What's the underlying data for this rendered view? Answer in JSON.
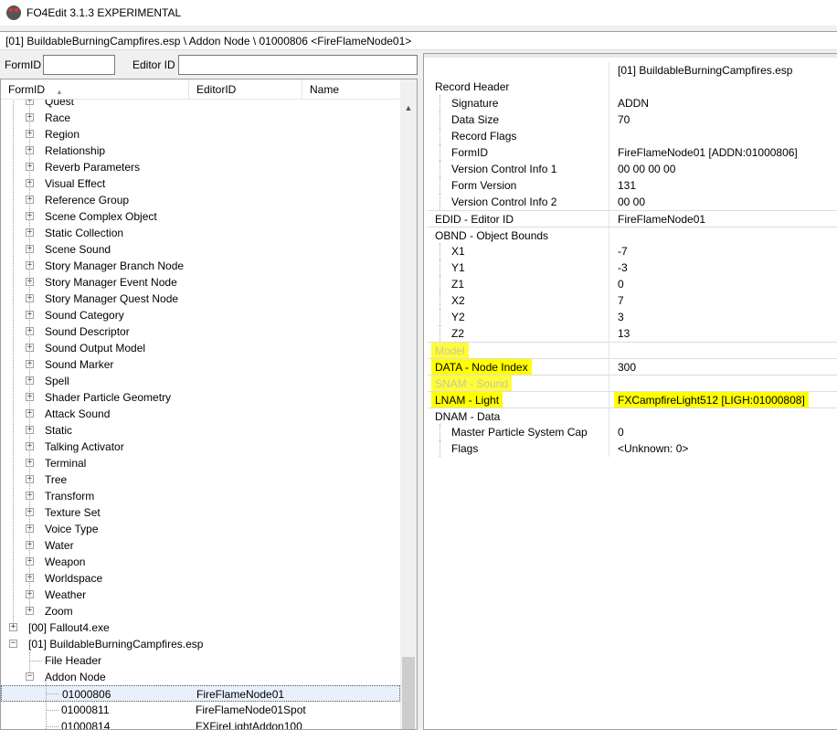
{
  "window": {
    "title": "FO4Edit 3.1.3 EXPERIMENTAL"
  },
  "path": "[01] BuildableBurningCampfires.esp \\ Addon Node \\ 01000806 <FireFlameNode01>",
  "filter": {
    "formid_label": "FormID",
    "formid_value": "",
    "editorid_label": "Editor ID",
    "editorid_value": ""
  },
  "tree": {
    "columns": [
      "FormID",
      "EditorID",
      "Name"
    ],
    "groups": [
      "Quest",
      "Race",
      "Region",
      "Relationship",
      "Reverb Parameters",
      "Visual Effect",
      "Reference Group",
      "Scene Complex Object",
      "Static Collection",
      "Scene Sound",
      "Story Manager Branch Node",
      "Story Manager Event Node",
      "Story Manager Quest Node",
      "Sound Category",
      "Sound Descriptor",
      "Sound Output Model",
      "Sound Marker",
      "Spell",
      "Shader Particle Geometry",
      "Attack Sound",
      "Static",
      "Talking Activator",
      "Terminal",
      "Tree",
      "Transform",
      "Texture Set",
      "Voice Type",
      "Water",
      "Weapon",
      "Worldspace",
      "Weather",
      "Zoom"
    ],
    "files": [
      "[00] Fallout4.exe",
      "[01] BuildableBurningCampfires.esp"
    ],
    "file_children": [
      "File Header",
      "Addon Node"
    ],
    "records": [
      {
        "formid": "01000806",
        "editorid": "FireFlameNode01"
      },
      {
        "formid": "01000811",
        "editorid": "FireFlameNode01Spot"
      },
      {
        "formid": "01000814",
        "editorid": "FXFireLightAddon100"
      }
    ]
  },
  "record": {
    "file_header": "[01] BuildableBurningCampfires.esp",
    "rows": [
      {
        "name": "Record Header",
        "value": "",
        "level": 0
      },
      {
        "name": "Signature",
        "value": "ADDN",
        "level": 1
      },
      {
        "name": "Data Size",
        "value": "70",
        "level": 1
      },
      {
        "name": "Record Flags",
        "value": "",
        "level": 1
      },
      {
        "name": "FormID",
        "value": "FireFlameNode01 [ADDN:01000806]",
        "level": 1
      },
      {
        "name": "Version Control Info 1",
        "value": "00 00 00 00",
        "level": 1
      },
      {
        "name": "Form Version",
        "value": "131",
        "level": 1
      },
      {
        "name": "Version Control Info 2",
        "value": "00 00",
        "level": 1
      },
      {
        "name": "EDID - Editor ID",
        "value": "FireFlameNode01",
        "level": 0
      },
      {
        "name": "OBND - Object Bounds",
        "value": "",
        "level": 0
      },
      {
        "name": "X1",
        "value": "-7",
        "level": 1
      },
      {
        "name": "Y1",
        "value": "-3",
        "level": 1
      },
      {
        "name": "Z1",
        "value": "0",
        "level": 1
      },
      {
        "name": "X2",
        "value": "7",
        "level": 1
      },
      {
        "name": "Y2",
        "value": "3",
        "level": 1
      },
      {
        "name": "Z2",
        "value": "13",
        "level": 1
      },
      {
        "name": "Model",
        "value": "",
        "level": 0
      },
      {
        "name": "DATA - Node Index",
        "value": "300",
        "level": 0
      },
      {
        "name": "SNAM - Sound",
        "value": "",
        "level": 0
      },
      {
        "name": "LNAM - Light",
        "value": "FXCampfireLight512 [LIGH:01000808]",
        "level": 0
      },
      {
        "name": "DNAM - Data",
        "value": "",
        "level": 0
      },
      {
        "name": "Master Particle System Cap",
        "value": "0",
        "level": 1
      },
      {
        "name": "Flags",
        "value": "<Unknown: 0>",
        "level": 1
      }
    ]
  },
  "colors": {
    "highlight": "#ffff00",
    "selected_row": "#e8f1fb",
    "disabled_text": "#c0c0c0"
  }
}
